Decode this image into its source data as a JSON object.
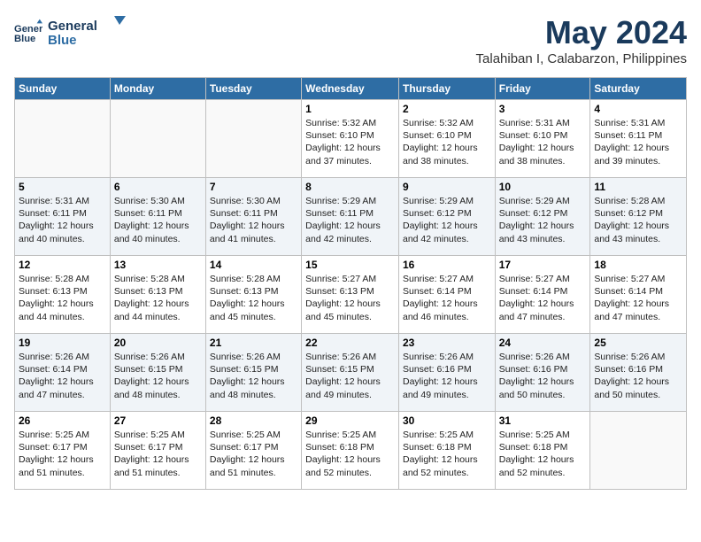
{
  "logo": {
    "line1": "General",
    "line2": "Blue"
  },
  "title": "May 2024",
  "location": "Talahiban I, Calabarzon, Philippines",
  "weekdays": [
    "Sunday",
    "Monday",
    "Tuesday",
    "Wednesday",
    "Thursday",
    "Friday",
    "Saturday"
  ],
  "weeks": [
    [
      {
        "day": "",
        "info": ""
      },
      {
        "day": "",
        "info": ""
      },
      {
        "day": "",
        "info": ""
      },
      {
        "day": "1",
        "sunrise": "5:32 AM",
        "sunset": "6:10 PM",
        "daylight": "12 hours and 37 minutes."
      },
      {
        "day": "2",
        "sunrise": "5:32 AM",
        "sunset": "6:10 PM",
        "daylight": "12 hours and 38 minutes."
      },
      {
        "day": "3",
        "sunrise": "5:31 AM",
        "sunset": "6:10 PM",
        "daylight": "12 hours and 38 minutes."
      },
      {
        "day": "4",
        "sunrise": "5:31 AM",
        "sunset": "6:11 PM",
        "daylight": "12 hours and 39 minutes."
      }
    ],
    [
      {
        "day": "5",
        "sunrise": "5:31 AM",
        "sunset": "6:11 PM",
        "daylight": "12 hours and 40 minutes."
      },
      {
        "day": "6",
        "sunrise": "5:30 AM",
        "sunset": "6:11 PM",
        "daylight": "12 hours and 40 minutes."
      },
      {
        "day": "7",
        "sunrise": "5:30 AM",
        "sunset": "6:11 PM",
        "daylight": "12 hours and 41 minutes."
      },
      {
        "day": "8",
        "sunrise": "5:29 AM",
        "sunset": "6:11 PM",
        "daylight": "12 hours and 42 minutes."
      },
      {
        "day": "9",
        "sunrise": "5:29 AM",
        "sunset": "6:12 PM",
        "daylight": "12 hours and 42 minutes."
      },
      {
        "day": "10",
        "sunrise": "5:29 AM",
        "sunset": "6:12 PM",
        "daylight": "12 hours and 43 minutes."
      },
      {
        "day": "11",
        "sunrise": "5:28 AM",
        "sunset": "6:12 PM",
        "daylight": "12 hours and 43 minutes."
      }
    ],
    [
      {
        "day": "12",
        "sunrise": "5:28 AM",
        "sunset": "6:13 PM",
        "daylight": "12 hours and 44 minutes."
      },
      {
        "day": "13",
        "sunrise": "5:28 AM",
        "sunset": "6:13 PM",
        "daylight": "12 hours and 44 minutes."
      },
      {
        "day": "14",
        "sunrise": "5:28 AM",
        "sunset": "6:13 PM",
        "daylight": "12 hours and 45 minutes."
      },
      {
        "day": "15",
        "sunrise": "5:27 AM",
        "sunset": "6:13 PM",
        "daylight": "12 hours and 45 minutes."
      },
      {
        "day": "16",
        "sunrise": "5:27 AM",
        "sunset": "6:14 PM",
        "daylight": "12 hours and 46 minutes."
      },
      {
        "day": "17",
        "sunrise": "5:27 AM",
        "sunset": "6:14 PM",
        "daylight": "12 hours and 47 minutes."
      },
      {
        "day": "18",
        "sunrise": "5:27 AM",
        "sunset": "6:14 PM",
        "daylight": "12 hours and 47 minutes."
      }
    ],
    [
      {
        "day": "19",
        "sunrise": "5:26 AM",
        "sunset": "6:14 PM",
        "daylight": "12 hours and 47 minutes."
      },
      {
        "day": "20",
        "sunrise": "5:26 AM",
        "sunset": "6:15 PM",
        "daylight": "12 hours and 48 minutes."
      },
      {
        "day": "21",
        "sunrise": "5:26 AM",
        "sunset": "6:15 PM",
        "daylight": "12 hours and 48 minutes."
      },
      {
        "day": "22",
        "sunrise": "5:26 AM",
        "sunset": "6:15 PM",
        "daylight": "12 hours and 49 minutes."
      },
      {
        "day": "23",
        "sunrise": "5:26 AM",
        "sunset": "6:16 PM",
        "daylight": "12 hours and 49 minutes."
      },
      {
        "day": "24",
        "sunrise": "5:26 AM",
        "sunset": "6:16 PM",
        "daylight": "12 hours and 50 minutes."
      },
      {
        "day": "25",
        "sunrise": "5:26 AM",
        "sunset": "6:16 PM",
        "daylight": "12 hours and 50 minutes."
      }
    ],
    [
      {
        "day": "26",
        "sunrise": "5:25 AM",
        "sunset": "6:17 PM",
        "daylight": "12 hours and 51 minutes."
      },
      {
        "day": "27",
        "sunrise": "5:25 AM",
        "sunset": "6:17 PM",
        "daylight": "12 hours and 51 minutes."
      },
      {
        "day": "28",
        "sunrise": "5:25 AM",
        "sunset": "6:17 PM",
        "daylight": "12 hours and 51 minutes."
      },
      {
        "day": "29",
        "sunrise": "5:25 AM",
        "sunset": "6:18 PM",
        "daylight": "12 hours and 52 minutes."
      },
      {
        "day": "30",
        "sunrise": "5:25 AM",
        "sunset": "6:18 PM",
        "daylight": "12 hours and 52 minutes."
      },
      {
        "day": "31",
        "sunrise": "5:25 AM",
        "sunset": "6:18 PM",
        "daylight": "12 hours and 52 minutes."
      },
      {
        "day": "",
        "info": ""
      }
    ]
  ]
}
